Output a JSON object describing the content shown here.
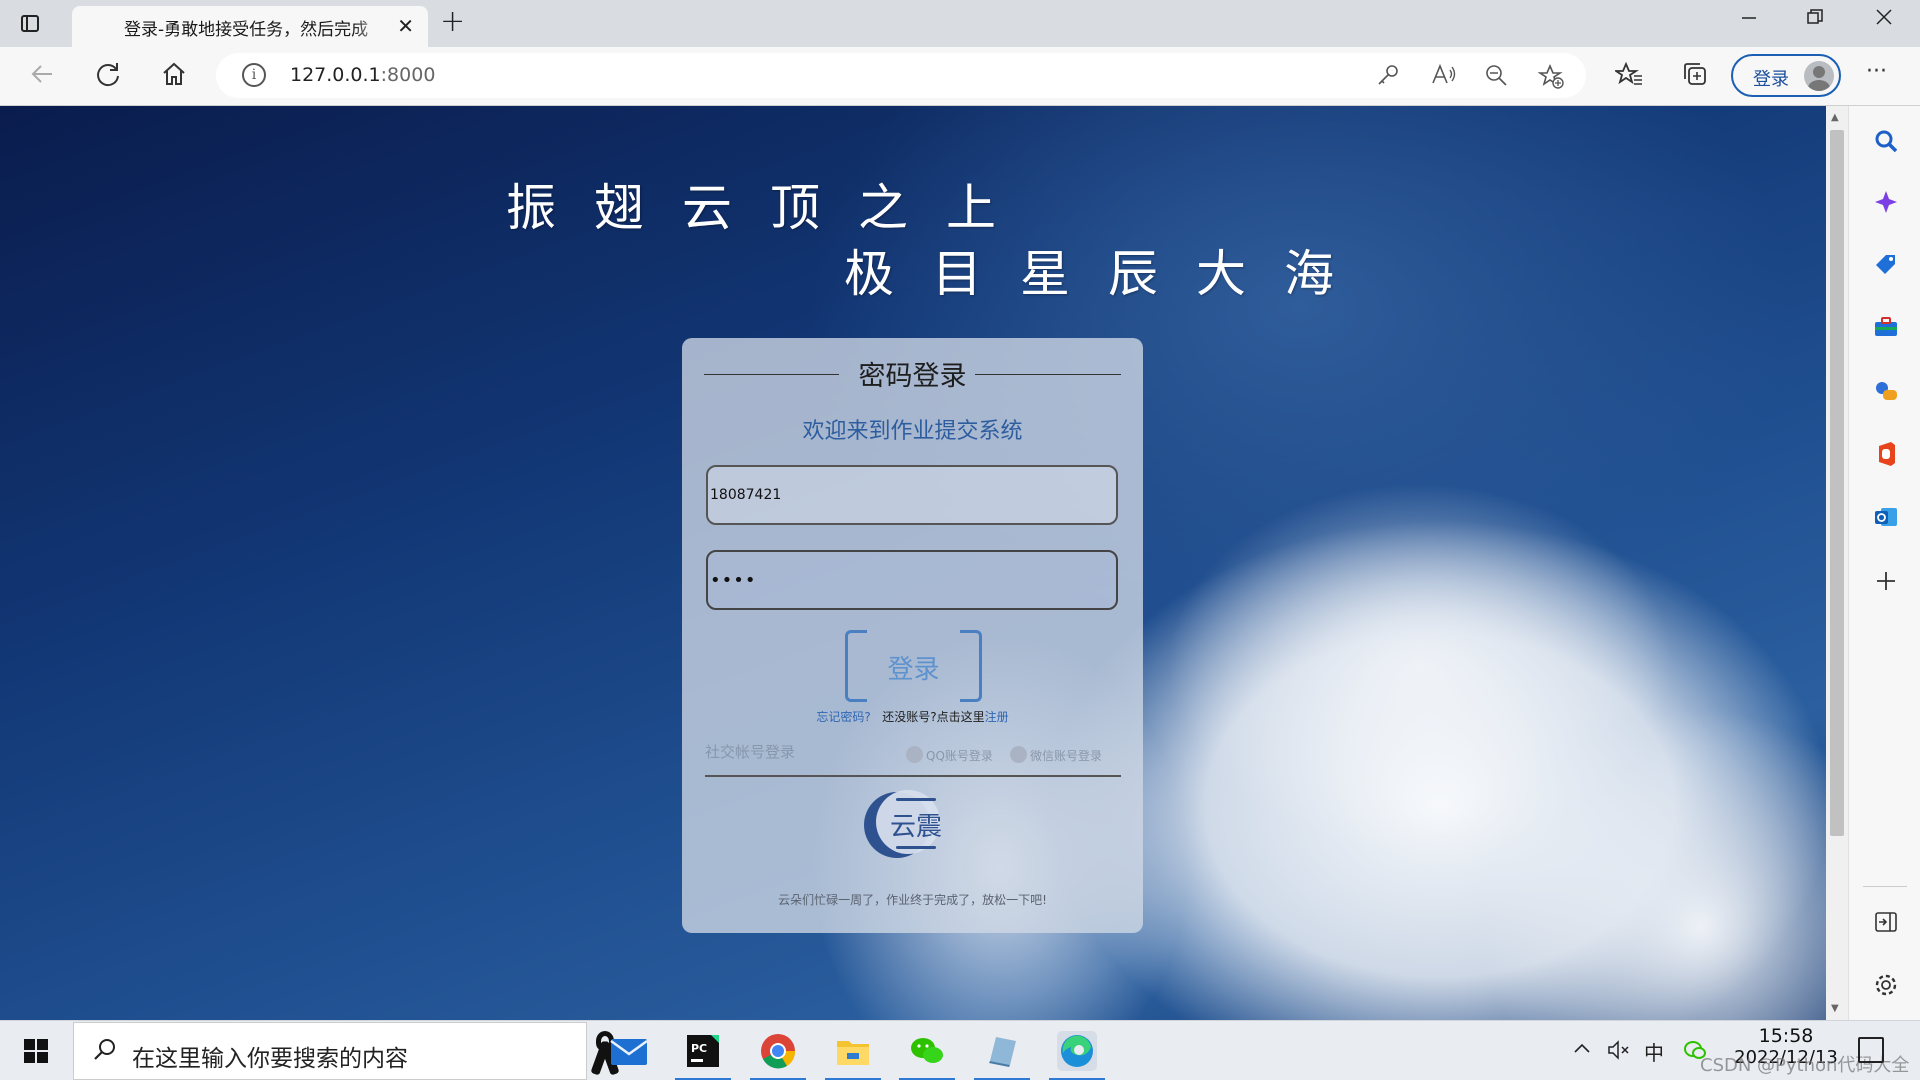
{
  "browser": {
    "tab_title": "登录-勇敢地接受任务，然后完成",
    "tab_close": "✕",
    "new_tab": "+",
    "address": {
      "host": "127.0.0.1",
      "port": ":8000"
    },
    "signin_label": "登录",
    "more": "···"
  },
  "page": {
    "slogan_line1": "振翅云顶之上",
    "slogan_line2": "极目星辰大海",
    "login_card": {
      "heading": "密码登录",
      "welcome": "欢迎来到作业提交系统",
      "username_value": "18087421",
      "password_value": "••••",
      "submit_label": "登录",
      "forgot_link": "忘记密码?",
      "no_account_text": "还没账号?点击这里",
      "register_link": "注册",
      "social_label": "社交帐号登录",
      "qq_login": "QQ账号登录",
      "wechat_login": "微信账号登录",
      "logo_text": "云震",
      "footer_note": "云朵们忙碌一周了，作业终于完成了，放松一下吧!"
    }
  },
  "taskbar": {
    "search_placeholder": "在这里输入你要搜索的内容",
    "ime_label": "中",
    "time": "15:58",
    "date": "2022/12/13",
    "watermark": "CSDN @Python代码大全"
  },
  "colors": {
    "accent_blue": "#2d5d9f",
    "button_blue": "#5e92cf",
    "edge_blue": "#1a5fb4"
  }
}
